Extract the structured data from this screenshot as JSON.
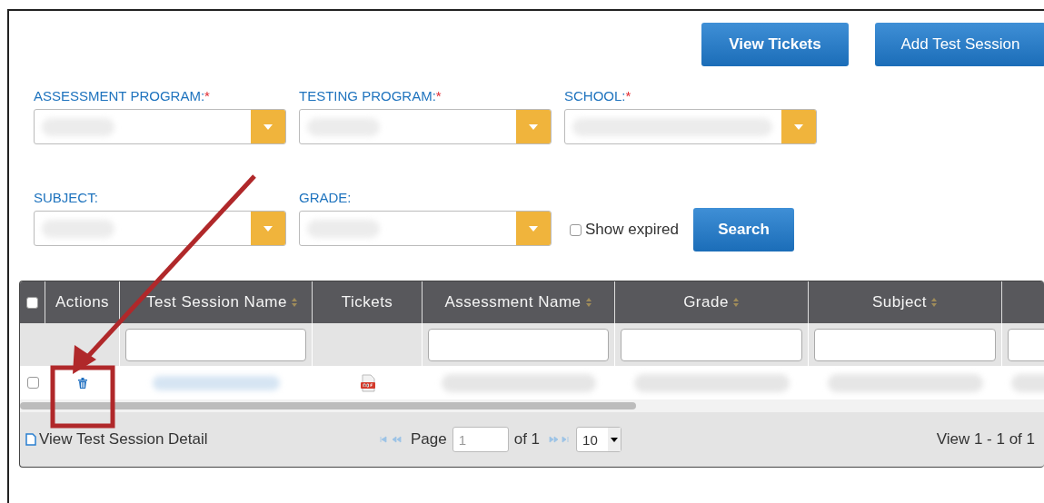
{
  "top_buttons": [
    "View Tickets",
    "Add Test Session"
  ],
  "filters": [
    {
      "label": "ASSESSMENT PROGRAM:",
      "required": true
    },
    {
      "label": "TESTING PROGRAM:",
      "required": true
    },
    {
      "label": "SCHOOL:",
      "required": true
    },
    {
      "label": "SUBJECT:",
      "required": false
    },
    {
      "label": "GRADE:",
      "required": false
    }
  ],
  "required_mark": "*",
  "show_expired": {
    "label": "Show expired",
    "checked": false
  },
  "search_button": "Search",
  "table": {
    "select_all": false,
    "columns": [
      {
        "label": "Actions",
        "sortable": false,
        "filter": false
      },
      {
        "label": "Test Session Name",
        "sortable": true,
        "filter": true
      },
      {
        "label": "Tickets",
        "sortable": false,
        "filter": false
      },
      {
        "label": "Assessment Name",
        "sortable": true,
        "filter": true
      },
      {
        "label": "Grade",
        "sortable": true,
        "filter": true
      },
      {
        "label": "Subject",
        "sortable": true,
        "filter": true
      },
      {
        "filter": true
      }
    ],
    "rows": [
      {
        "checked": false,
        "cells": [
          {
            "kind": "delete"
          },
          {
            "kind": "redacted-link"
          },
          {
            "kind": "pdf"
          },
          {
            "kind": "redacted"
          },
          {
            "kind": "redacted"
          },
          {
            "kind": "redacted"
          },
          {
            "kind": "redacted"
          }
        ]
      }
    ]
  },
  "pager": {
    "detail_link": "View Test Session Detail",
    "page_label": "Page",
    "page": "1",
    "of": "of 1",
    "page_size": "10",
    "summary": "View 1 - 1 of 1"
  }
}
